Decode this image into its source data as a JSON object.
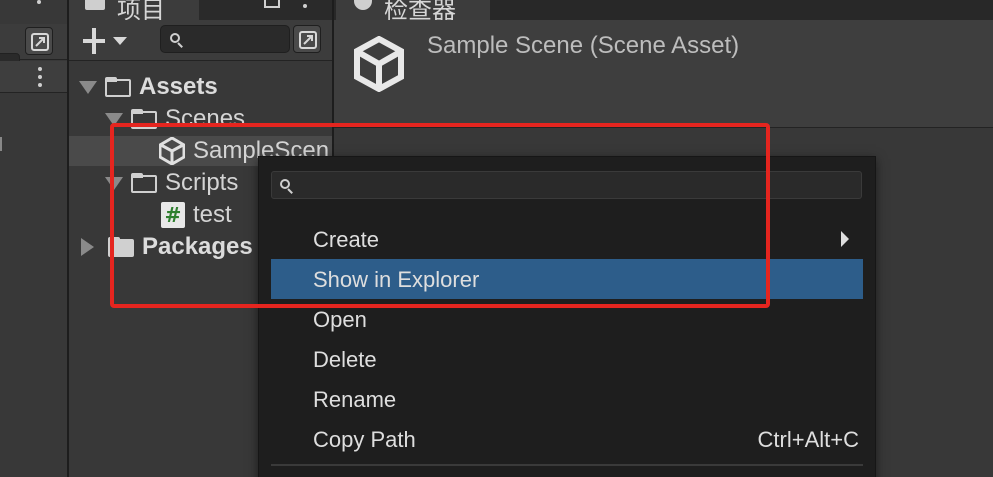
{
  "project_panel": {
    "tab_label": "项目",
    "search": {
      "value": "",
      "placeholder": ""
    },
    "tree": {
      "assets": "Assets",
      "scenes": "Scenes",
      "sample_scene": "SampleScen",
      "scripts": "Scripts",
      "test": "test",
      "packages": "Packages"
    }
  },
  "inspector": {
    "tab_label": "检查器",
    "title": "Sample Scene (Scene Asset)"
  },
  "context_menu": {
    "search": {
      "value": "",
      "placeholder": ""
    },
    "items": [
      {
        "label": "Create",
        "submenu": true
      },
      {
        "label": "Show in Explorer",
        "highlighted": true
      },
      {
        "label": "Open"
      },
      {
        "label": "Delete"
      },
      {
        "label": "Rename"
      },
      {
        "label": "Copy Path",
        "shortcut": "Ctrl+Alt+C"
      }
    ]
  },
  "icons": [
    "plus-icon",
    "dropdown-caret-icon",
    "search-icon",
    "object-picker-icon",
    "kebab-menu-icon",
    "folder-icon",
    "unity-scene-icon",
    "csharp-script-icon",
    "info-icon",
    "submenu-arrow-icon"
  ],
  "colors": {
    "menu_highlight": "#2d5d8a",
    "annotation_red": "#e5251f",
    "panel_bg": "#383838",
    "menu_bg": "#1e1e1e"
  }
}
